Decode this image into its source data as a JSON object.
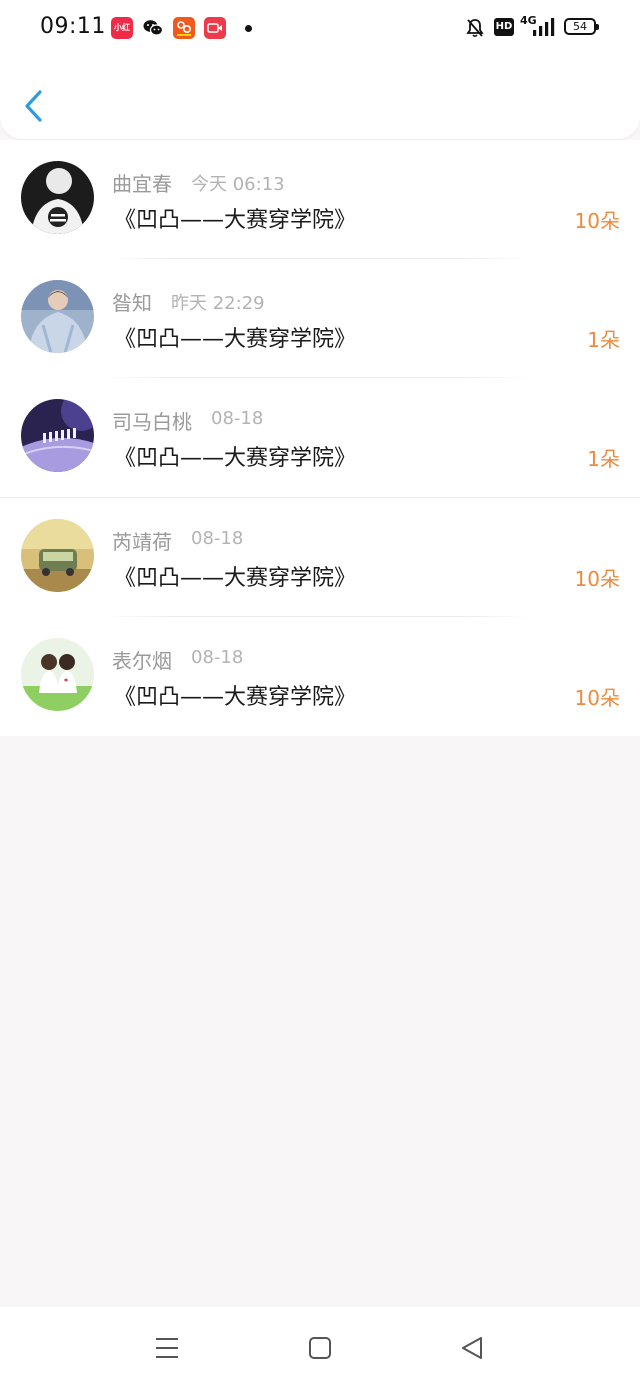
{
  "status_bar": {
    "time": "09:11",
    "xhs_label": "小红书",
    "network": "4G",
    "hd_label": "HD",
    "battery": "54"
  },
  "header": {
    "back_icon": "chevron-left-icon"
  },
  "entries": [
    {
      "name": "曲宜春",
      "time": "今天 06:13",
      "title": "《凹凸——大赛穿学院》",
      "amount": "10朵"
    },
    {
      "name": "昝知",
      "time": "昨天 22:29",
      "title": "《凹凸——大赛穿学院》",
      "amount": "1朵"
    },
    {
      "name": "司马白桃",
      "time": "08-18",
      "title": "《凹凸——大赛穿学院》",
      "amount": "1朵"
    },
    {
      "name": "芮靖荷",
      "time": "08-18",
      "title": "《凹凸——大赛穿学院》",
      "amount": "10朵"
    },
    {
      "name": "表尔烟",
      "time": "08-18",
      "title": "《凹凸——大赛穿学院》",
      "amount": "10朵"
    }
  ],
  "colors": {
    "accent_back": "#2f9bdf",
    "amount": "#ee8a3c"
  }
}
